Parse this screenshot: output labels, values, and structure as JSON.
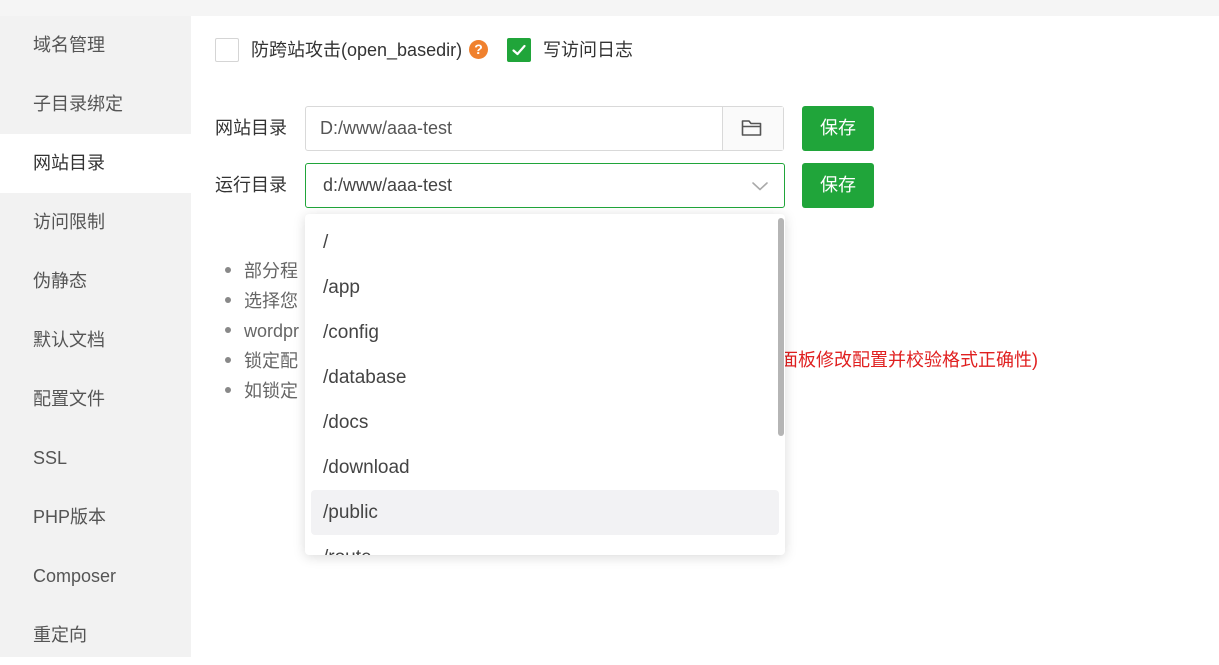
{
  "sidebar": {
    "items": [
      {
        "label": "域名管理"
      },
      {
        "label": "子目录绑定"
      },
      {
        "label": "网站目录"
      },
      {
        "label": "访问限制"
      },
      {
        "label": "伪静态"
      },
      {
        "label": "默认文档"
      },
      {
        "label": "配置文件"
      },
      {
        "label": "SSL"
      },
      {
        "label": "PHP版本"
      },
      {
        "label": "Composer"
      },
      {
        "label": "重定向"
      }
    ]
  },
  "options": {
    "anti_xss_label": "防跨站攻击(open_basedir)",
    "help_icon_text": "?",
    "access_log_label": "写访问日志"
  },
  "site_dir": {
    "label": "网站目录",
    "value": "D:/www/aaa-test",
    "save_label": "保存"
  },
  "run_dir": {
    "label": "运行目录",
    "value": "d:/www/aaa-test",
    "save_label": "保存",
    "options": [
      "/",
      "/app",
      "/config",
      "/database",
      "/docs",
      "/download",
      "/public",
      "/route"
    ]
  },
  "tips": {
    "items": [
      "部分程",
      "选择您",
      "wordpr",
      "锁定配",
      "如锁定"
    ],
    "red_tail": "面板修改配置并校验格式正确性)"
  }
}
